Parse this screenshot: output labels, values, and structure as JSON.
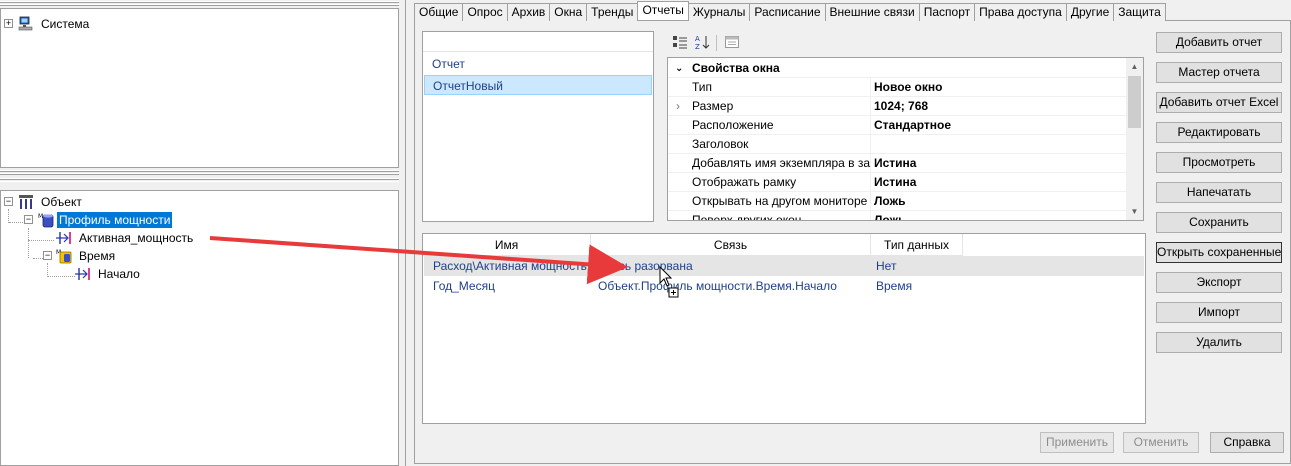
{
  "tree_top": {
    "items": [
      {
        "label": "Система"
      }
    ]
  },
  "tree_bottom": {
    "items": [
      {
        "label": "Объект"
      },
      {
        "label": "Профиль мощности"
      },
      {
        "label": "Активная_мощность"
      },
      {
        "label": "Время"
      },
      {
        "label": "Начало"
      }
    ]
  },
  "tabs": [
    "Общие",
    "Опрос",
    "Архив",
    "Окна",
    "Тренды",
    "Отчеты",
    "Журналы",
    "Расписание",
    "Внешние связи",
    "Паспорт",
    "Права доступа",
    "Другие",
    "Защита"
  ],
  "reports": [
    "Отчет",
    "ОтчетНовый"
  ],
  "properties": {
    "category": "Свойства окна",
    "rows": [
      {
        "name": "Тип",
        "value": "Новое окно"
      },
      {
        "name": "Размер",
        "value": "1024; 768"
      },
      {
        "name": "Расположение",
        "value": "Стандартное"
      },
      {
        "name": "Заголовок",
        "value": ""
      },
      {
        "name": "Добавлять имя экземпляра в заголовок",
        "value": "Истина"
      },
      {
        "name": "Отображать рамку",
        "value": "Истина"
      },
      {
        "name": "Открывать на другом мониторе",
        "value": "Ложь"
      },
      {
        "name": "Поверх других окон",
        "value": "Ложь"
      }
    ]
  },
  "bindings": {
    "headers": [
      "Имя",
      "Связь",
      "Тип данных"
    ],
    "rows": [
      [
        "Расход\\Активная мощность",
        "Связь разорвана",
        "Нет"
      ],
      [
        "Год_Месяц",
        "Объект.Профиль мощности.Время.Начало",
        "Время"
      ]
    ]
  },
  "buttons": {
    "add_report": "Добавить отчет",
    "report_wizard": "Мастер отчета",
    "add_excel": "Добавить отчет Excel",
    "edit": "Редактировать",
    "preview": "Просмотреть",
    "print": "Напечатать",
    "save": "Сохранить",
    "open_saved": "Открыть сохраненные",
    "export": "Экспорт",
    "import": "Импорт",
    "delete": "Удалить",
    "apply": "Применить",
    "cancel": "Отменить",
    "help": "Справка"
  },
  "colors": {
    "selection": "#0078d7",
    "arrow": "#e83a3a",
    "link_text": "#1f3f8a"
  }
}
